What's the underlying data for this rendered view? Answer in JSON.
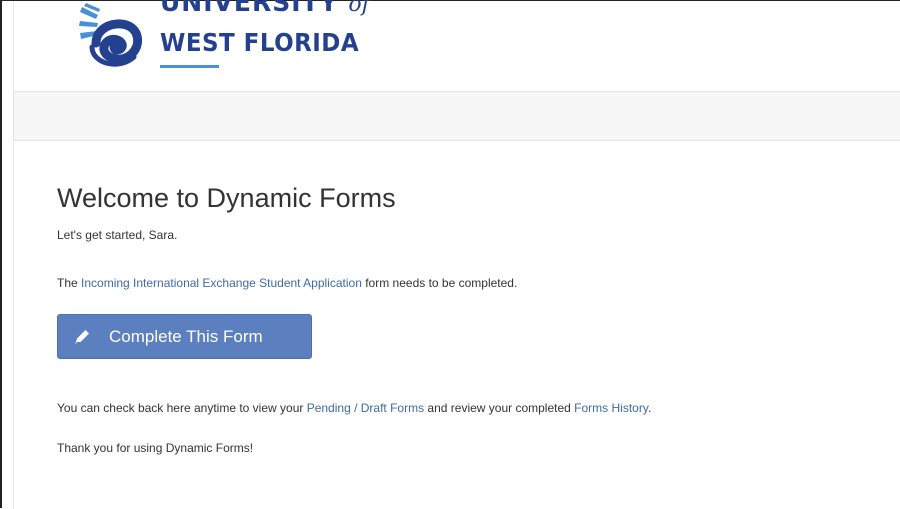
{
  "header": {
    "logo_line1": "UNIVERSITY",
    "logo_of": "of",
    "logo_line2": "WEST FLORIDA",
    "brand_color": "#24418f",
    "accent_color": "#4a90d9"
  },
  "main": {
    "title": "Welcome to Dynamic Forms",
    "subtitle": "Let's get started, Sara.",
    "form_notice": {
      "prefix": "The ",
      "form_link": "Incoming International Exchange Student Application",
      "suffix": " form needs to be completed."
    },
    "complete_button": {
      "label": "Complete This Form",
      "icon": "pencil-icon",
      "color": "#5b7fbf"
    },
    "check_back": {
      "prefix": "You can check back here anytime to view your ",
      "pending_link": "Pending / Draft Forms",
      "middle": " and review your completed ",
      "history_link": "Forms History",
      "suffix": "."
    },
    "thanks": "Thank you for using Dynamic Forms!"
  },
  "link_color": "#3e6aa7"
}
